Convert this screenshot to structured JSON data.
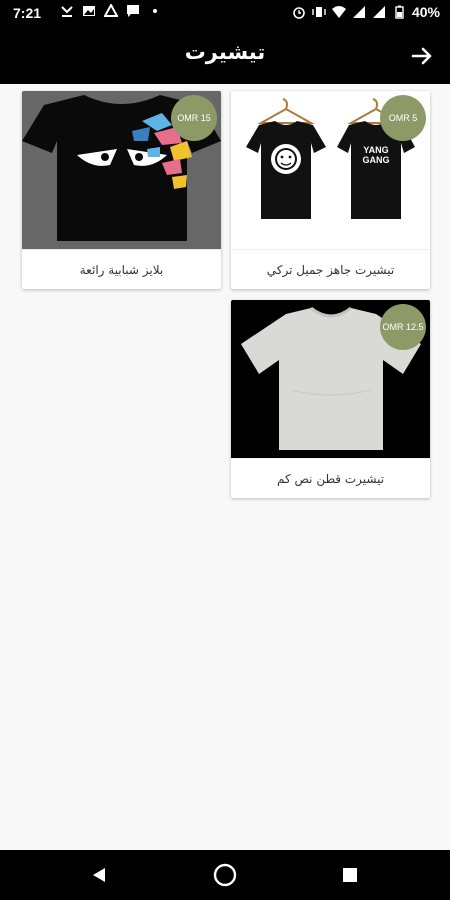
{
  "status_bar": {
    "time": "7:21",
    "battery": "40%"
  },
  "header": {
    "title": "تيشيرت",
    "back_icon": "arrow-right-icon"
  },
  "products": [
    {
      "name": "تيشيرت جاهز جميل تركي",
      "price": "OMR 5",
      "image": "two-black-tshirts-on-hangers"
    },
    {
      "name": "بلايز شبابية رائعة",
      "price": "OMR 15",
      "image": "black-tshirt-angry-eyes-print"
    },
    {
      "name": "تيشيرت قطن نص كم",
      "price": "OMR 12.5",
      "image": "grey-cotton-tshirt"
    }
  ],
  "colors": {
    "bars": "#000000",
    "price_badge": "#8d9a68",
    "background": "#f8f8f8"
  }
}
